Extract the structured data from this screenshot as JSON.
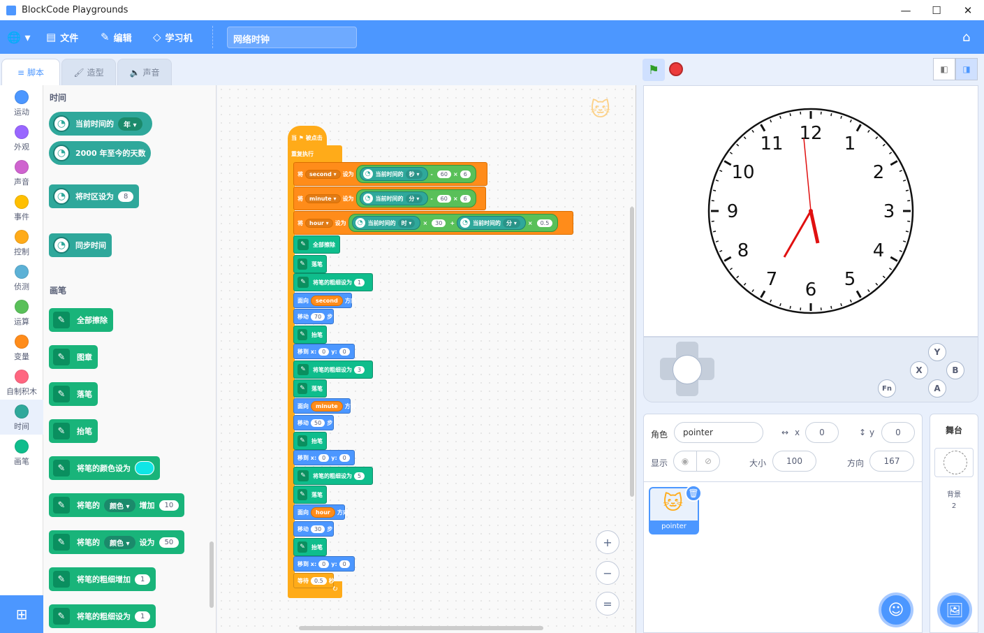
{
  "window": {
    "title": "BlockCode Playgrounds",
    "minimize": "—",
    "maximize": "☐",
    "close": "✕"
  },
  "menu": {
    "language": "🌐 ▾",
    "file": "文件",
    "edit": "编辑",
    "learn": "学习机",
    "project_title": "网络时钟"
  },
  "tabs": {
    "code": "脚本",
    "costumes": "造型",
    "sounds": "声音"
  },
  "categories": [
    "运动",
    "外观",
    "声音",
    "事件",
    "控制",
    "侦测",
    "运算",
    "变量",
    "自制积木",
    "时间",
    "画笔"
  ],
  "category_colors": [
    "#4c97ff",
    "#9966ff",
    "#cf63cf",
    "#ffbf00",
    "#ffab19",
    "#5cb1d6",
    "#59c059",
    "#ff8c1a",
    "#ff6680",
    "#2fa89b",
    "#0fbd8c"
  ],
  "palette": {
    "time_title": "时间",
    "current_time": "当前时间的",
    "current_time_dd": "年 ▾",
    "days_since": "2000 年至今的天数",
    "set_timezone": "将时区设为",
    "timezone_val": "8",
    "sync_time": "同步时间",
    "pen_title": "画笔",
    "clear": "全部擦除",
    "stamp": "图章",
    "pen_down": "落笔",
    "pen_up": "抬笔",
    "set_color": "将笔的颜色设为",
    "change_param": "将笔的",
    "param_dd": "颜色 ▾",
    "change_by": "增加",
    "change_val": "10",
    "set_param": "将笔的",
    "set_to": "设为",
    "set_val": "50",
    "change_size": "将笔的粗细增加",
    "change_size_val": "1",
    "set_size": "将笔的粗细设为",
    "set_size_val": "1"
  },
  "script": {
    "hat": "当 ⚑ 被点击",
    "forever": "重复执行",
    "set_label": "将",
    "to_label": "设为",
    "var_second": "second ▾",
    "var_minute": "minute ▾",
    "var_hour": "hour ▾",
    "cur_time": "当前时间的",
    "sec_dd": "秒 ▾",
    "min_dd": "分 ▾",
    "hour_dd": "时 ▾",
    "minus": "-",
    "times": "×",
    "plus": "+",
    "n60": "60",
    "n6": "6",
    "n30": "30",
    "n05": "0.5",
    "clear": "全部擦除",
    "pen_down": "落笔",
    "pen_up": "抬笔",
    "set_size": "将笔的粗细设为",
    "size1": "1",
    "size3": "3",
    "size5": "5",
    "point": "面向",
    "dir": "方向",
    "rep_second": "second",
    "rep_minute": "minute",
    "rep_hour": "hour",
    "move": "移动",
    "steps": "步",
    "move70": "70",
    "move50": "50",
    "move30": "30",
    "goto": "移到 x:",
    "y": "y:",
    "zero": "0",
    "wait": "等待",
    "sec": "秒"
  },
  "zoom": {
    "in": "+",
    "out": "−",
    "reset": "="
  },
  "clock": {
    "numbers": [
      "12",
      "1",
      "2",
      "3",
      "4",
      "5",
      "6",
      "7",
      "8",
      "9",
      "10",
      "11"
    ]
  },
  "gamepad": {
    "y": "Y",
    "x": "X",
    "b": "B",
    "a": "A",
    "fn": "Fn"
  },
  "sprite": {
    "label": "角色",
    "name": "pointer",
    "x_label": "x",
    "x": "0",
    "y_label": "y",
    "y": "0",
    "show_label": "显示",
    "size_label": "大小",
    "size": "100",
    "dir_label": "方向",
    "dir": "167",
    "tile_name": "pointer"
  },
  "stage_panel": {
    "title": "舞台",
    "bg_label": "背景",
    "bg_count": "2"
  }
}
